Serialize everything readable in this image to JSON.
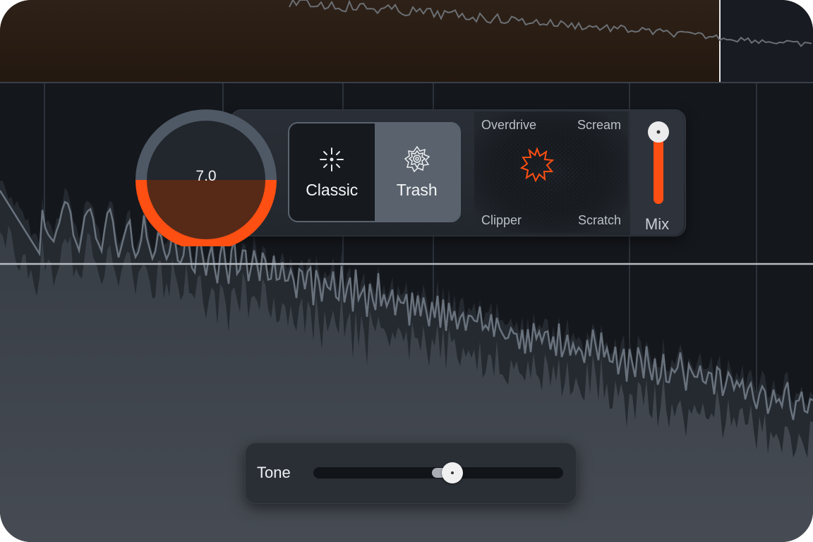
{
  "drive": {
    "value_text": "7.0",
    "level": 0.5
  },
  "mode": {
    "options": [
      {
        "label": "Classic",
        "icon": "sparkle-icon",
        "selected": false
      },
      {
        "label": "Trash",
        "icon": "mandala-icon",
        "selected": true
      }
    ]
  },
  "xy_pad": {
    "top_left": "Overdrive",
    "top_right": "Scream",
    "bottom_left": "Clipper",
    "bottom_right": "Scratch",
    "icon": "starburst-icon"
  },
  "mix": {
    "label": "Mix",
    "level": 1.0
  },
  "tone": {
    "label": "Tone",
    "level": 0.55
  },
  "colors": {
    "accent": "#ff4f12",
    "background": "#14171c",
    "panel": "#262a31"
  }
}
